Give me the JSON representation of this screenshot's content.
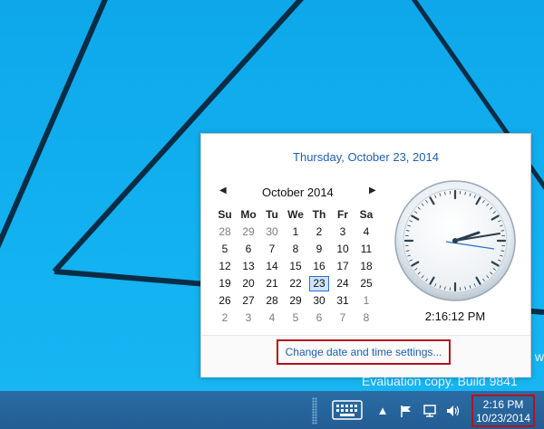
{
  "flyout": {
    "long_date": "Thursday, October 23, 2014",
    "month_label": "October 2014",
    "nav_prev": "◀",
    "nav_next": "▶",
    "weekdays": [
      "Su",
      "Mo",
      "Tu",
      "We",
      "Th",
      "Fr",
      "Sa"
    ],
    "weeks": [
      [
        "28",
        "29",
        "30",
        "1",
        "2",
        "3",
        "4"
      ],
      [
        "5",
        "6",
        "7",
        "8",
        "9",
        "10",
        "11"
      ],
      [
        "12",
        "13",
        "14",
        "15",
        "16",
        "17",
        "18"
      ],
      [
        "19",
        "20",
        "21",
        "22",
        "23",
        "24",
        "25"
      ],
      [
        "26",
        "27",
        "28",
        "29",
        "30",
        "31",
        "1"
      ],
      [
        "2",
        "3",
        "4",
        "5",
        "6",
        "7",
        "8"
      ]
    ],
    "today": "23",
    "digital_time": "2:16:12 PM",
    "change_link": "Change date and time settings..."
  },
  "desktop": {
    "watermark_fragment": "w",
    "watermark": "Evaluation copy. Build 9841"
  },
  "taskbar": {
    "clock_time": "2:16 PM",
    "clock_date": "10/23/2014",
    "icons": [
      "touch-keyboard-icon",
      "chevron-up-icon",
      "flag-icon",
      "network-icon",
      "speaker-icon"
    ]
  },
  "colors": {
    "desktop_bg": "#0aa6e6",
    "taskbar_bg": "#2b6ca4",
    "link": "#1e5fb0",
    "highlight_border": "#b4131b"
  }
}
